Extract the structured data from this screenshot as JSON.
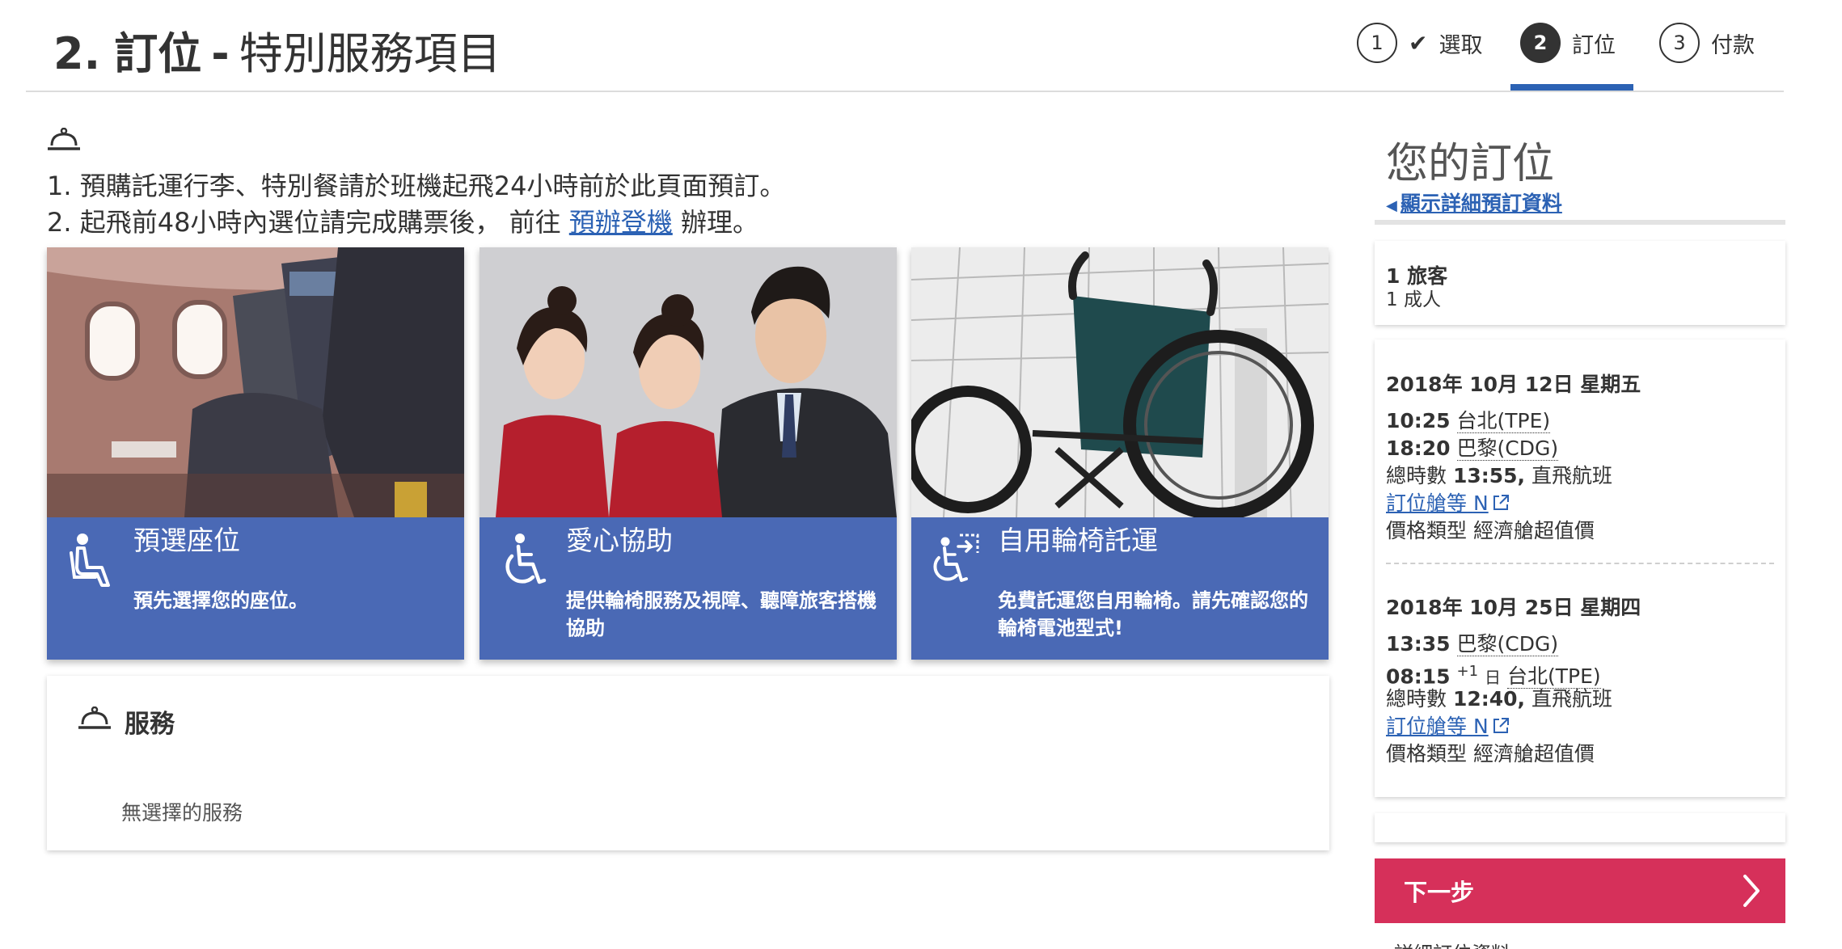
{
  "header": {
    "step_number": "2.",
    "title_bold": "訂位",
    "title_rest": "特別服務項目"
  },
  "steps": [
    {
      "number": "1",
      "label": "選取",
      "state": "completed"
    },
    {
      "number": "2",
      "label": "訂位",
      "state": "active"
    },
    {
      "number": "3",
      "label": "付款",
      "state": "upcoming"
    }
  ],
  "notice": {
    "icon": "service-bell-icon",
    "line1": "1. 預購託運行李、特別餐請於班機起飛24小時前於此頁面預訂。",
    "line2_prefix": "2. 起飛前48小時內選位請完成購票後， 前往 ",
    "line2_link": "預辦登機",
    "line2_suffix": " 辦理。"
  },
  "cards": [
    {
      "icon": "seat-icon",
      "title": "預選座位",
      "description": "預先選擇您的座位。"
    },
    {
      "icon": "wheelchair-icon",
      "title": "愛心協助",
      "description": "提供輪椅服務及視障、聽障旅客搭機協助"
    },
    {
      "icon": "wheelchair-exit-icon",
      "title": "自用輪椅託運",
      "description": "免費託運您自用輪椅。請先確認您的輪椅電池型式!"
    }
  ],
  "services": {
    "icon": "service-bell-icon",
    "title": "服務",
    "empty_text": "無選擇的服務"
  },
  "sidebar": {
    "title": "您的訂位",
    "detail_link": "顯示詳細預訂資料",
    "passengers": {
      "count": "1 旅客",
      "type": "1 成人"
    },
    "segments": [
      {
        "date": "2018年 10月 12日 星期五",
        "depart_time": "10:25",
        "depart_city": "台北(TPE)",
        "arrive_time": "18:20",
        "arrive_next_day": "",
        "arrive_city": "巴黎(CDG)",
        "duration_label": "總時數",
        "duration": "13:55,",
        "flight_type": "直飛航班",
        "booking_class_label": "訂位艙等",
        "booking_class": "N",
        "fare_label": "價格類型",
        "fare_type": "經濟艙超值價"
      },
      {
        "date": "2018年 10月 25日 星期四",
        "depart_time": "13:35",
        "depart_city": "巴黎(CDG)",
        "arrive_time": "08:15",
        "arrive_next_day_sup": "+1",
        "arrive_next_day": "日",
        "arrive_city": "台北(TPE)",
        "duration_label": "總時數",
        "duration": "12:40,",
        "flight_type": "直飛航班",
        "booking_class_label": "訂位艙等",
        "booking_class": "N",
        "fare_label": "價格類型",
        "fare_type": "經濟艙超值價"
      }
    ],
    "next_button": "下一步",
    "footer_text": "詳細訂位資料"
  },
  "colors": {
    "primary_blue": "#2c62b4",
    "card_blue": "#4a69b5",
    "next_red": "#d6305a",
    "text": "#333333"
  }
}
